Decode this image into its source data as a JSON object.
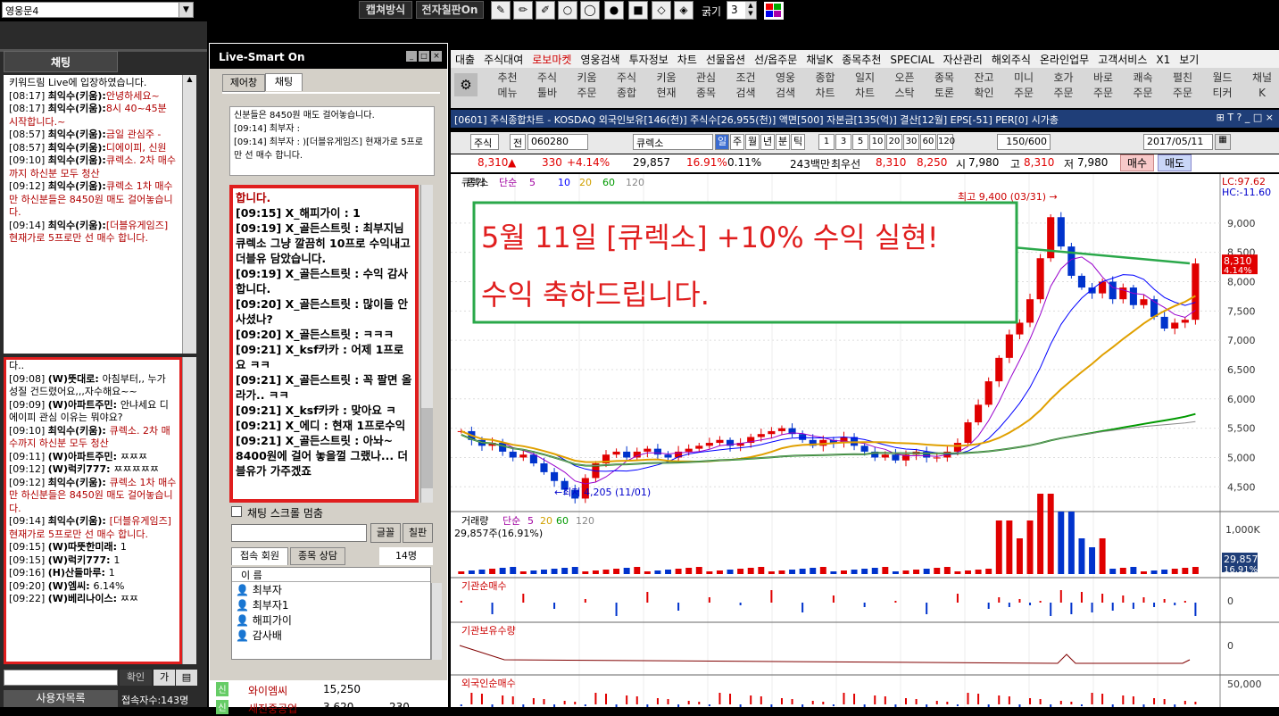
{
  "topbar": {
    "room_select": "영웅문4",
    "capture_label": "캡쳐방식",
    "board_label": "전자칠판On",
    "thickness_label": "굵기",
    "thickness_value": "3"
  },
  "left_chat": {
    "header": "채팅",
    "messages_top": [
      {
        "text": "키워드림 Live에 입장하였습니다.",
        "style": "plain"
      },
      {
        "time": "[08:17]",
        "who": "최익수(키움):",
        "text": "안녕하세요~"
      },
      {
        "time": "[08:17]",
        "who": "최익수(키움):",
        "text": "8시 40~45분 시작합니다.~"
      },
      {
        "time": "[08:57]",
        "who": "최익수(키움):",
        "text": "금일 관심주 -"
      },
      {
        "time": "[08:57]",
        "who": "최익수(키움):",
        "text": "디에이피, 신원"
      },
      {
        "time": "[09:10]",
        "who": "최익수(키움):",
        "text": "큐렉소. 2차 매수까지 하신분 모두 청산"
      },
      {
        "time": "[09:12]",
        "who": "최익수(키움):",
        "text": "큐렉소 1차 매수만 하신분들은 8450원 매도 걸어놓습니다."
      },
      {
        "time": "[09:14]",
        "who": "최익수(키움):",
        "text": "[더블유게임즈] 현재가로 5프로만 선 매수 합니다."
      }
    ],
    "messages_bottom": [
      {
        "time": "",
        "who": "",
        "text": "다.."
      },
      {
        "time": "[09:08]",
        "who": "(W)뜻대로:",
        "text": "아침부터,, 누가 성질 건드렸어요,,,자수해요~~",
        "plain": true
      },
      {
        "time": "[09:09]",
        "who": "(W)아파트주민:",
        "text": "안냐세요 디에이피 관심 이유는 뭐야요?",
        "plain": true
      },
      {
        "time": "[09:10]",
        "who": "최익수(키움):",
        "text": "큐렉소. 2차 매수까지 하신분 모두 청산"
      },
      {
        "time": "[09:11]",
        "who": "(W)아파트주민:",
        "text": "ㅉㅉㅉ",
        "plain": true
      },
      {
        "time": "[09:12]",
        "who": "(W)럭키777:",
        "text": "ㅉㅉㅉㅉㅉ",
        "plain": true
      },
      {
        "time": "[09:12]",
        "who": "최익수(키움):",
        "text": "큐렉소 1차 매수만 하신분들은 8450원 매도 걸어놓습니다."
      },
      {
        "time": "[09:14]",
        "who": "최익수(키움):",
        "text": "[더블유게임즈] 현재가로 5프로만 선 매수 합니다."
      },
      {
        "time": "[09:15]",
        "who": "(W)따뜻한미래:",
        "text": "1",
        "plain": true
      },
      {
        "time": "[09:15]",
        "who": "(W)럭키777:",
        "text": "1",
        "plain": true
      },
      {
        "time": "[09:16]",
        "who": "(H)산들마루:",
        "text": "1",
        "plain": true
      },
      {
        "time": "[09:20]",
        "who": "(W)엠씨:",
        "text": "6.14%",
        "plain": true
      },
      {
        "time": "[09:22]",
        "who": "(W)베리나이스:",
        "text": "ㅉㅉ",
        "plain": true
      }
    ],
    "confirm_label": "확인",
    "user_list_label": "사용자목록",
    "visitor_count": "접속자수:143명"
  },
  "smart": {
    "title": "Live-Smart On",
    "tab_control": "제어창",
    "tab_chat": "채팅",
    "notice_lines": [
      "신분들은 8450원 매도 걸어놓습니다.",
      "[09:14] 최부자 :",
      "[09:14] 최부자 : )[더블유게임즈] 현재가로 5프로만 선 매수 합니다."
    ],
    "chat_lines": [
      "합니다.",
      "[09:15] X_해피가이 : 1",
      "[09:19] X_골든스트릿 : 최부지님 큐렉소 그냥 깔끔히 10프로 수익내고 더블유 담았습니다.",
      "[09:19] X_골든스트릿 : 수익 감사합니다.",
      "[09:20] X_골든스트릿 : 많이들 안사셨나?",
      "[09:20] X_골든스트릿 : ㅋㅋㅋ",
      "[09:21] X_ksf카카 : 어제 1프로요 ㅋㅋ",
      "[09:21] X_골든스트릿 : 꼭 팔면 올라가.. ㅋㅋ",
      "[09:21] X_ksf카카 : 맞아요 ㅋ",
      "[09:21] X_에디 : 현재 1프로수익",
      "[09:21] X_골든스트릿 : 아놔~ 8400원에 걸어 놓을껄 그랬나... 더블유가 가주겠죠"
    ],
    "scroll_stop_label": "채팅 스크롤 멈춤",
    "font_btn": "글꼴",
    "board_btn": "칠판",
    "tab_members": "접속 회원",
    "tab_consult": "종목 상담",
    "member_count": "14명",
    "name_header": "이 름",
    "members": [
      "최부자",
      "최부자1",
      "해피가이",
      "감사배"
    ]
  },
  "menu": [
    "대출",
    "주식대여",
    "로보마켓",
    "영웅검색",
    "투자정보",
    "차트",
    "선물옵션",
    "선/옵주문",
    "채널K",
    "종목추천",
    "SPECIAL",
    "자산관리",
    "해외주식",
    "온라인업무",
    "고객서비스",
    "X1",
    "보기"
  ],
  "icon_buttons": [
    [
      "추천",
      "메뉴"
    ],
    [
      "주식",
      "툴바"
    ],
    [
      "키움",
      "주문"
    ],
    [
      "주식",
      "종합"
    ],
    [
      "키움",
      "현재"
    ],
    [
      "관심",
      "종목"
    ],
    [
      "조건",
      "검색"
    ],
    [
      "영웅",
      "검색"
    ],
    [
      "종합",
      "차트"
    ],
    [
      "일지",
      "차트"
    ],
    [
      "오픈",
      "스탁"
    ],
    [
      "종목",
      "토론"
    ],
    [
      "잔고",
      "확인"
    ],
    [
      "미니",
      "주문"
    ],
    [
      "호가",
      "주문"
    ],
    [
      "바로",
      "주문"
    ],
    [
      "쾌속",
      "주문"
    ],
    [
      "펼친",
      "주문"
    ],
    [
      "월드",
      "티커"
    ],
    [
      "채널",
      "K"
    ]
  ],
  "chart_window": {
    "title": "[0601] 주식종합차트 - KOSDAQ 외국인보유[146(천)] 주식수[26,955(천)] 액면[500] 자본금[135(억)] 결산[12월] EPS[-51] PER[0] 시가총",
    "mode": "주식",
    "prev_label": "전",
    "code": "060280",
    "stock_name": "큐렉소",
    "periods": [
      "일",
      "주",
      "월",
      "년",
      "분",
      "틱"
    ],
    "minute_steps": [
      "1",
      "3",
      "5",
      "10",
      "20",
      "30",
      "60",
      "120"
    ],
    "count": "150",
    "count_total": "/600",
    "date": "2017/05/11",
    "price": "8,310",
    "change": "330",
    "change_pct": "+4.14%",
    "volume": "29,857",
    "vol_pct": "16.91%",
    "ratio": "0.11%",
    "amount": "243백만",
    "best_ask_label": "최우선",
    "best_ask": "8,310",
    "best_bid": "8,250",
    "open_label": "시",
    "open": "7,980",
    "high_label": "고",
    "high": "8,310",
    "low_label": "저",
    "low": "7,980",
    "buy_label": "매수",
    "sell_label": "매도"
  },
  "chart_data": [
    {
      "type": "line",
      "title": "큐렉소",
      "legend": [
        "종가",
        "단순",
        "5",
        "10",
        "20",
        "60",
        "120"
      ],
      "y_ticks": [
        "9,000",
        "8,500",
        "8,000",
        "7,500",
        "7,000",
        "6,500",
        "6,000",
        "5,500",
        "5,000",
        "4,500"
      ],
      "ylim": [
        4200,
        9500
      ],
      "annotations": {
        "high": "최고 9,400 (03/31)",
        "low": "최저 4,205 (11/01)",
        "lc": "LC:97.62",
        "hc": "HC:-11.60",
        "last_price": "8,310",
        "last_pct": "4.14%"
      },
      "overlay_text": [
        "5월 11일 [큐렉소] +10% 수익 실현!",
        "수익 축하드립니다."
      ],
      "series": [
        {
          "name": "종가",
          "values": [
            5450,
            5300,
            5200,
            5250,
            5100,
            5000,
            5050,
            4900,
            4750,
            4600,
            4450,
            4300,
            4650,
            4900,
            5050,
            5100,
            5000,
            5100,
            5150,
            5050,
            5000,
            5100,
            5150,
            5200,
            5250,
            5300,
            5200,
            5250,
            5350,
            5400,
            5450,
            5500,
            5400,
            5300,
            5200,
            5300,
            5250,
            5350,
            5200,
            5100,
            5000,
            5050,
            4950,
            5050,
            5100,
            5000,
            5000,
            5100,
            5250,
            5600,
            5900,
            6300,
            6700,
            7100,
            7300,
            7700,
            8400,
            9100,
            8600,
            8100,
            7900,
            7800,
            8000,
            7700,
            7900,
            7600,
            7700,
            7400,
            7200,
            7300,
            7350,
            8310
          ]
        }
      ]
    },
    {
      "type": "bar",
      "title": "거래량",
      "legend": [
        "단순",
        "5",
        "20",
        "60",
        "120"
      ],
      "value_label": "29,857주(16.91%)",
      "y_ticks": [
        "1,000K"
      ],
      "last": "29,857",
      "last_pct": "16.91%"
    },
    {
      "type": "bar",
      "title": "기관순매수",
      "y_ticks": [
        "0"
      ]
    },
    {
      "type": "line",
      "title": "기관보유수량",
      "y_ticks": [
        "0"
      ]
    },
    {
      "type": "bar",
      "title": "외국인순매수",
      "y_ticks": [
        "50,000",
        "0"
      ]
    }
  ],
  "bottom_stocks": [
    {
      "name": "와이엠씨",
      "price": "15,250"
    },
    {
      "name": "세진중공업",
      "price": "3,620",
      "change": "230"
    }
  ],
  "colors": {
    "up": "#e00000",
    "down": "#0033cc",
    "ma5": "#9900cc",
    "ma10": "#0000ff",
    "ma20": "#e0a000",
    "ma60": "#009900",
    "ma120": "#888888",
    "highlight_red": "#e01e1e",
    "highlight_green": "#2aa84a"
  }
}
